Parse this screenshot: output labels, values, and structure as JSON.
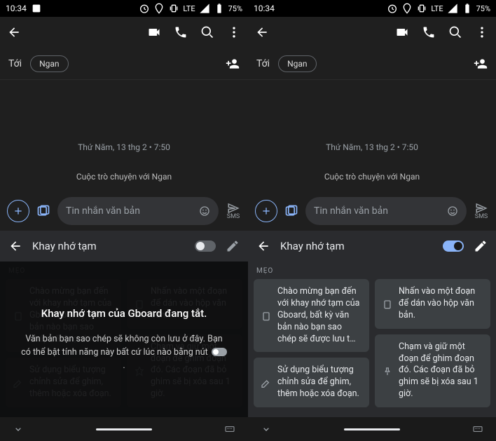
{
  "status": {
    "time": "10:34",
    "network": "LTE",
    "battery": "75%"
  },
  "appbar": {
    "back": "back-icon",
    "video": "video-icon",
    "call": "call-icon",
    "search": "search-icon",
    "more": "more-icon"
  },
  "recipient": {
    "to_label": "Tới",
    "chip": "Ngan",
    "group_add": "group-add-icon"
  },
  "conversation": {
    "timestamp": "Thứ Năm, 13 thg 2 • 7:50",
    "sys_msg": "Cuộc trò chuyện với Ngan"
  },
  "compose": {
    "placeholder": "Tin nhắn văn bản",
    "send_label": "SMS"
  },
  "clipboard": {
    "title": "Khay nhớ tạm",
    "tips_label": "MẸO",
    "tips": [
      "Chào mừng bạn đến với khay nhớ tạm của Gboard, bất kỳ văn bản nào bạn sao chép sẽ được lưu t…",
      "Sử dụng biểu tượng chỉnh sửa để ghim, thêm hoặc xóa đoạn.",
      "Nhấn vào một đoạn để dán vào hộp văn bản.",
      "Chạm và giữ một đoạn để ghim đoạn đó. Các đoạn đã bỏ ghim sẽ bị xóa sau 1 giờ."
    ]
  },
  "overlay": {
    "title": "Khay nhớ tạm của Gboard đang tắt.",
    "body_pre": "Văn bản bạn sao chép sẽ không còn lưu ở đây. Bạn có thể bật tính năng này bất cứ lúc nào bằng nút",
    "body_post": "."
  }
}
